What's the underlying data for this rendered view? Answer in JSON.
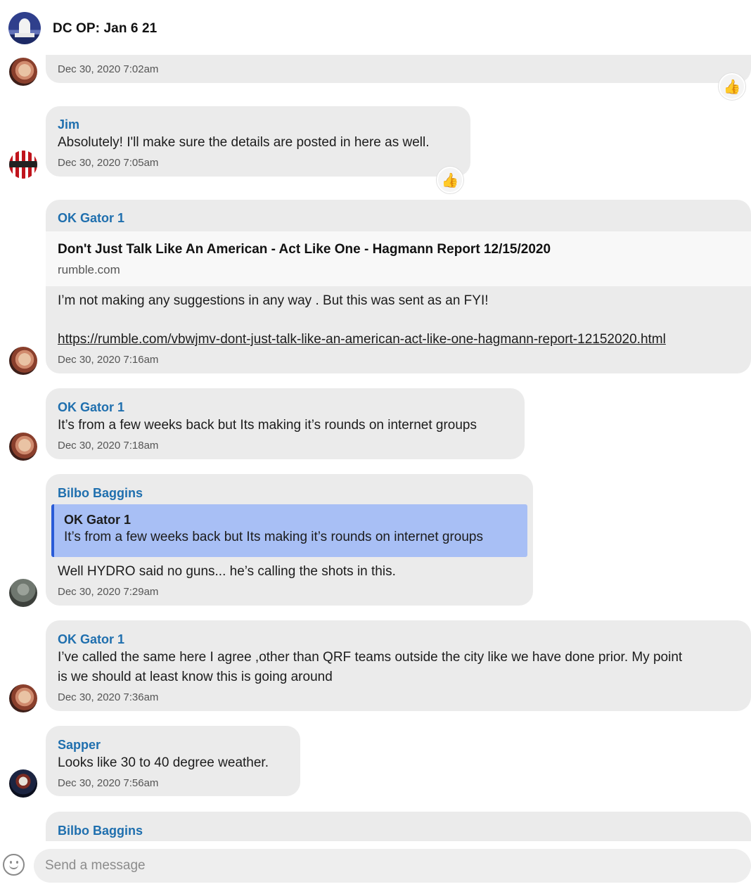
{
  "header": {
    "title": "DC OP: Jan 6 21"
  },
  "messages": [
    {
      "sender": "",
      "text": "",
      "time": "Dec 30, 2020 7:02am",
      "reaction": "thumbs-up"
    },
    {
      "sender": "Jim",
      "text": "Absolutely! I'll make sure the details are posted in here as well.",
      "time": "Dec 30, 2020 7:05am",
      "reaction": "thumbs-up"
    },
    {
      "sender": "OK Gator 1",
      "link_preview": {
        "title": "Don't Just Talk Like An American - Act Like One - Hagmann Report 12/15/2020",
        "domain": "rumble.com"
      },
      "text": "I’m not making any suggestions in any way . But this was sent as an FYI!",
      "url": "https://rumble.com/vbwjmv-dont-just-talk-like-an-american-act-like-one-hagmann-report-12152020.html",
      "time": "Dec 30, 2020 7:16am"
    },
    {
      "sender": "OK Gator 1",
      "text": "It’s from a few weeks back but Its making it’s rounds on internet groups",
      "time": "Dec 30, 2020 7:18am"
    },
    {
      "sender": "Bilbo Baggins",
      "quote": {
        "sender": "OK Gator 1",
        "text": "It’s from a few weeks back but Its making it’s rounds on internet groups"
      },
      "text": "Well HYDRO said no guns... he’s calling the shots in this.",
      "time": "Dec 30, 2020 7:29am"
    },
    {
      "sender": "OK Gator 1",
      "text_line1": "I’ve called the same here I agree ,other than QRF teams outside the city like we have done prior. My point",
      "text_line2": "is we should at least know this is going around",
      "time": "Dec 30, 2020 7:36am"
    },
    {
      "sender": "Sapper",
      "text": "Looks like 30 to 40 degree weather.",
      "time": "Dec 30, 2020 7:56am"
    },
    {
      "sender": "Bilbo Baggins"
    }
  ],
  "composer": {
    "placeholder": "Send a message"
  },
  "icons": {
    "reaction": "👍",
    "emoji": "smiley-face-icon"
  },
  "colors": {
    "sender": "#1f6fae",
    "bubble": "#ebebeb",
    "quote_bg": "#a8bff5",
    "quote_bar": "#2a5bd7"
  }
}
